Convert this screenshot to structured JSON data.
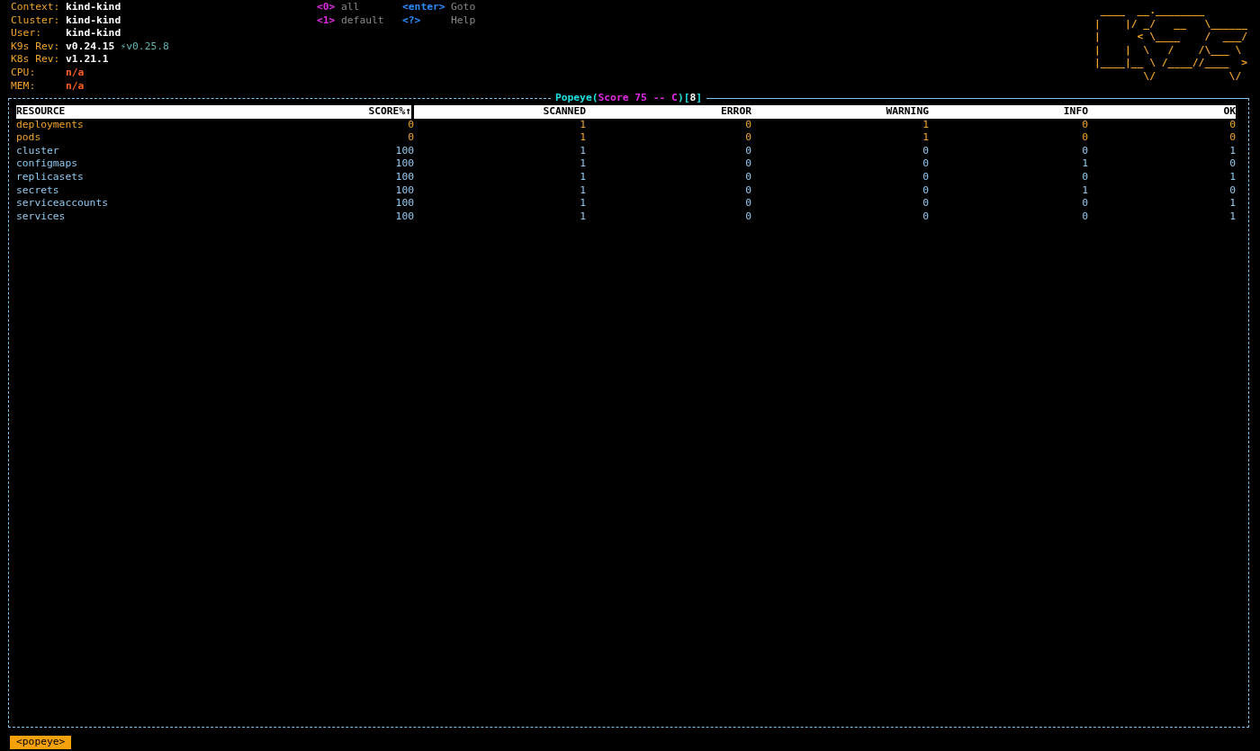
{
  "info": [
    {
      "label": "Context:",
      "value": "kind-kind",
      "kind": "plain"
    },
    {
      "label": "Cluster:",
      "value": "kind-kind",
      "kind": "plain"
    },
    {
      "label": "User:",
      "value": "kind-kind",
      "kind": "plain"
    },
    {
      "label": "K9s Rev:",
      "value": "v0.24.15",
      "kind": "plain",
      "upgrade": "⚡v0.25.8"
    },
    {
      "label": "K8s Rev:",
      "value": "v1.21.1",
      "kind": "plain"
    },
    {
      "label": "CPU:",
      "value": "n/a",
      "kind": "na"
    },
    {
      "label": "MEM:",
      "value": "n/a",
      "kind": "na"
    }
  ],
  "hints": [
    [
      {
        "key": "<0>",
        "action": "all",
        "kind": "namespace"
      },
      {
        "key": "<enter>",
        "action": "Goto",
        "kind": "command"
      }
    ],
    [
      {
        "key": "<1>",
        "action": "default",
        "kind": "namespace"
      },
      {
        "key": "<?>",
        "action": "Help",
        "kind": "command"
      }
    ]
  ],
  "logo": [
    " ____  __.________       ",
    "|    |/ _/   __   \\______",
    "|      < \\____    /  ___/",
    "|    |  \\   /    /\\___ \\ ",
    "|____|__ \\ /____//____  >",
    "        \\/            \\/ "
  ],
  "title": [
    {
      "text": "Popeye(",
      "kind": "name"
    },
    {
      "text": "Score 75 -- C",
      "kind": "score"
    },
    {
      "text": ")[",
      "kind": "name"
    },
    {
      "text": "8",
      "kind": "count"
    },
    {
      "text": "]",
      "kind": "name"
    }
  ],
  "table": {
    "columns": [
      "RESOURCE",
      "SCORE%↑",
      "SCANNED",
      "ERROR",
      "WARNING",
      "INFO",
      "OK"
    ],
    "rows": [
      {
        "kind": "warning",
        "cells": [
          "deployments",
          "0",
          "1",
          "0",
          "1",
          "0",
          "0"
        ]
      },
      {
        "kind": "warning",
        "cells": [
          "pods",
          "0",
          "1",
          "0",
          "1",
          "0",
          "0"
        ]
      },
      {
        "kind": "ok",
        "cells": [
          "cluster",
          "100",
          "1",
          "0",
          "0",
          "0",
          "1"
        ]
      },
      {
        "kind": "ok",
        "cells": [
          "configmaps",
          "100",
          "1",
          "0",
          "0",
          "1",
          "0"
        ]
      },
      {
        "kind": "ok",
        "cells": [
          "replicasets",
          "100",
          "1",
          "0",
          "0",
          "0",
          "1"
        ]
      },
      {
        "kind": "ok",
        "cells": [
          "secrets",
          "100",
          "1",
          "0",
          "0",
          "1",
          "0"
        ]
      },
      {
        "kind": "ok",
        "cells": [
          "serviceaccounts",
          "100",
          "1",
          "0",
          "0",
          "0",
          "1"
        ]
      },
      {
        "kind": "ok",
        "cells": [
          "services",
          "100",
          "1",
          "0",
          "0",
          "0",
          "1"
        ]
      }
    ]
  },
  "breadcrumb": "<popeye>"
}
